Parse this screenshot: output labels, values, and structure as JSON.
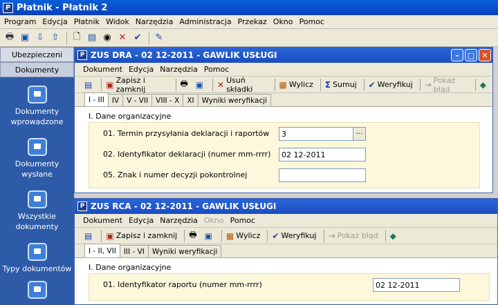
{
  "app": {
    "title": "Płatnik - Płatnik 2"
  },
  "menu": [
    "Program",
    "Edycja",
    "Płatnik",
    "Widok",
    "Narzędzia",
    "Administracja",
    "Przekaz",
    "Okno",
    "Pomoc"
  ],
  "sidebar": {
    "tabs": [
      "Ubezpieczeni",
      "Dokumenty"
    ],
    "items": [
      {
        "label": "Dokumenty wprowadzone"
      },
      {
        "label": "Dokumenty wysłane"
      },
      {
        "label": "Wszystkie dokumenty"
      },
      {
        "label": "Typy dokumentów"
      }
    ]
  },
  "dra": {
    "title": "ZUS DRA - 02 12-2011 - GAWLIK USŁUGI",
    "menu": [
      "Dokument",
      "Edycja",
      "Narzędzia",
      "Pomoc"
    ],
    "toolbar": {
      "save_close": "Zapisz i zamknij",
      "delete": "Usuń składki",
      "calc": "Wylicz",
      "sum": "Sumuj",
      "verify": "Weryfikuj",
      "show_error": "Pokaż błąd"
    },
    "tabs": [
      "I - III",
      "IV",
      "V - VII",
      "VIII - X",
      "XI",
      "Wyniki weryfikacji"
    ],
    "section": "I. Dane organizacyjne",
    "fields": [
      {
        "label": "01. Termin przysyłania deklaracji i raportów",
        "value": "3"
      },
      {
        "label": "02. Identyfikator deklaracji (numer mm-rrrr)",
        "value": "02 12-2011"
      },
      {
        "label": "05. Znak i numer decyzji pokontrolnej",
        "value": ""
      }
    ]
  },
  "rca": {
    "title": "ZUS RCA - 02 12-2011 - GAWLIK USŁUGI",
    "menu": [
      "Dokument",
      "Edycja",
      "Narzędzia",
      "Okno",
      "Pomoc"
    ],
    "toolbar": {
      "save_close": "Zapisz i zamknij",
      "calc": "Wylicz",
      "verify": "Weryfikuj",
      "show_error": "Pokaż błąd"
    },
    "tabs": [
      "I - II, VII",
      "III - VI",
      "Wyniki weryfikacji"
    ],
    "section": "I. Dane organizacyjne",
    "fields": [
      {
        "label": "01. Identyfikator raportu (numer mm-rrrr)",
        "value": "02 12-2011"
      }
    ]
  }
}
